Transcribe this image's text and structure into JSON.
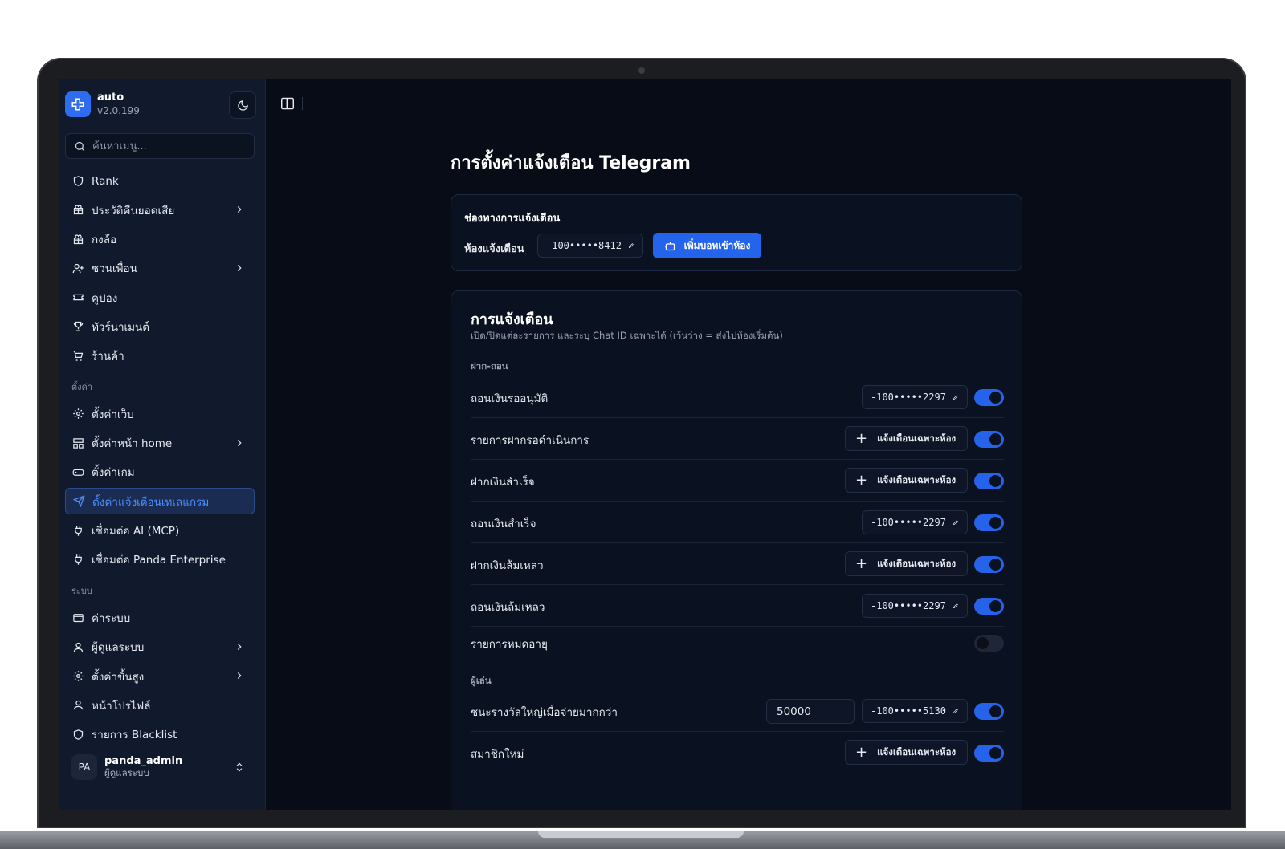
{
  "app": {
    "name": "auto",
    "version": "v2.0.199"
  },
  "search": {
    "placeholder": "ค้นหาเมนู..."
  },
  "sidebar": {
    "items": [
      {
        "label": "Rank"
      },
      {
        "label": "ประวัติคืนยอดเสีย"
      },
      {
        "label": "กงล้อ"
      },
      {
        "label": "ชวนเพื่อน"
      },
      {
        "label": "คูปอง"
      },
      {
        "label": "ทัวร์นาเมนต์"
      },
      {
        "label": "ร้านค้า"
      }
    ],
    "settings_label": "ตั้งค่า",
    "settings_items": [
      {
        "label": "ตั้งค่าเว็บ"
      },
      {
        "label": "ตั้งค่าหน้า home"
      },
      {
        "label": "ตั้งค่าเกม"
      },
      {
        "label": "ตั้งค่าแจ้งเตือนเทเลแกรม"
      },
      {
        "label": "เชื่อมต่อ AI (MCP)"
      },
      {
        "label": "เชื่อมต่อ Panda Enterprise"
      }
    ],
    "system_label": "ระบบ",
    "system_items": [
      {
        "label": "ค่าระบบ"
      },
      {
        "label": "ผู้ดูแลระบบ"
      },
      {
        "label": "ตั้งค่าขั้นสูง"
      },
      {
        "label": "หน้าโปรไฟล์"
      },
      {
        "label": "รายการ Blacklist"
      }
    ]
  },
  "user": {
    "initials": "PA",
    "name": "panda_admin",
    "role": "ผู้ดูแลระบบ"
  },
  "page": {
    "title": "การตั้งค่าแจ้งเตือน Telegram"
  },
  "channel": {
    "title": "ช่องทางการแจ้งเตือน",
    "room_label": "ห้องแจ้งเตือน",
    "room_chat_id": "-100•••••8412",
    "add_bot_label": "เพิ่มบอทเข้าห้อง"
  },
  "notifications": {
    "title": "การแจ้งเตือน",
    "description": "เปิด/ปิดแต่ละรายการ และระบุ Chat ID เฉพาะได้ (เว้นว่าง = ส่งไปห้องเริ่มต้น)",
    "add_room_label": "แจ้งเตือนเฉพาะห้อง",
    "groups": [
      {
        "label": "ฝาก-ถอน",
        "rows": [
          {
            "label": "ถอนเงินรออนุมัติ",
            "chat_id": "-100•••••2297",
            "enabled": true
          },
          {
            "label": "รายการฝากรอดำเนินการ",
            "chat_id": null,
            "enabled": true
          },
          {
            "label": "ฝากเงินสำเร็จ",
            "chat_id": null,
            "enabled": true
          },
          {
            "label": "ถอนเงินสำเร็จ",
            "chat_id": "-100•••••2297",
            "enabled": true
          },
          {
            "label": "ฝากเงินล้มเหลว",
            "chat_id": null,
            "enabled": true
          },
          {
            "label": "ถอนเงินล้มเหลว",
            "chat_id": "-100•••••2297",
            "enabled": true
          },
          {
            "label": "รายการหมดอายุ",
            "chat_id": null,
            "enabled": false
          }
        ]
      },
      {
        "label": "ผู้เล่น",
        "rows": [
          {
            "label": "ชนะรางวัลใหญ่เมื่อจ่ายมากกว่า",
            "amount": "50000",
            "chat_id": "-100•••••5130",
            "enabled": true
          },
          {
            "label": "สมาชิกใหม่",
            "chat_id": null,
            "enabled": true
          }
        ]
      }
    ]
  },
  "colors": {
    "accent": "#2563eb",
    "background": "#080c17",
    "sidebar": "#111a2c"
  }
}
